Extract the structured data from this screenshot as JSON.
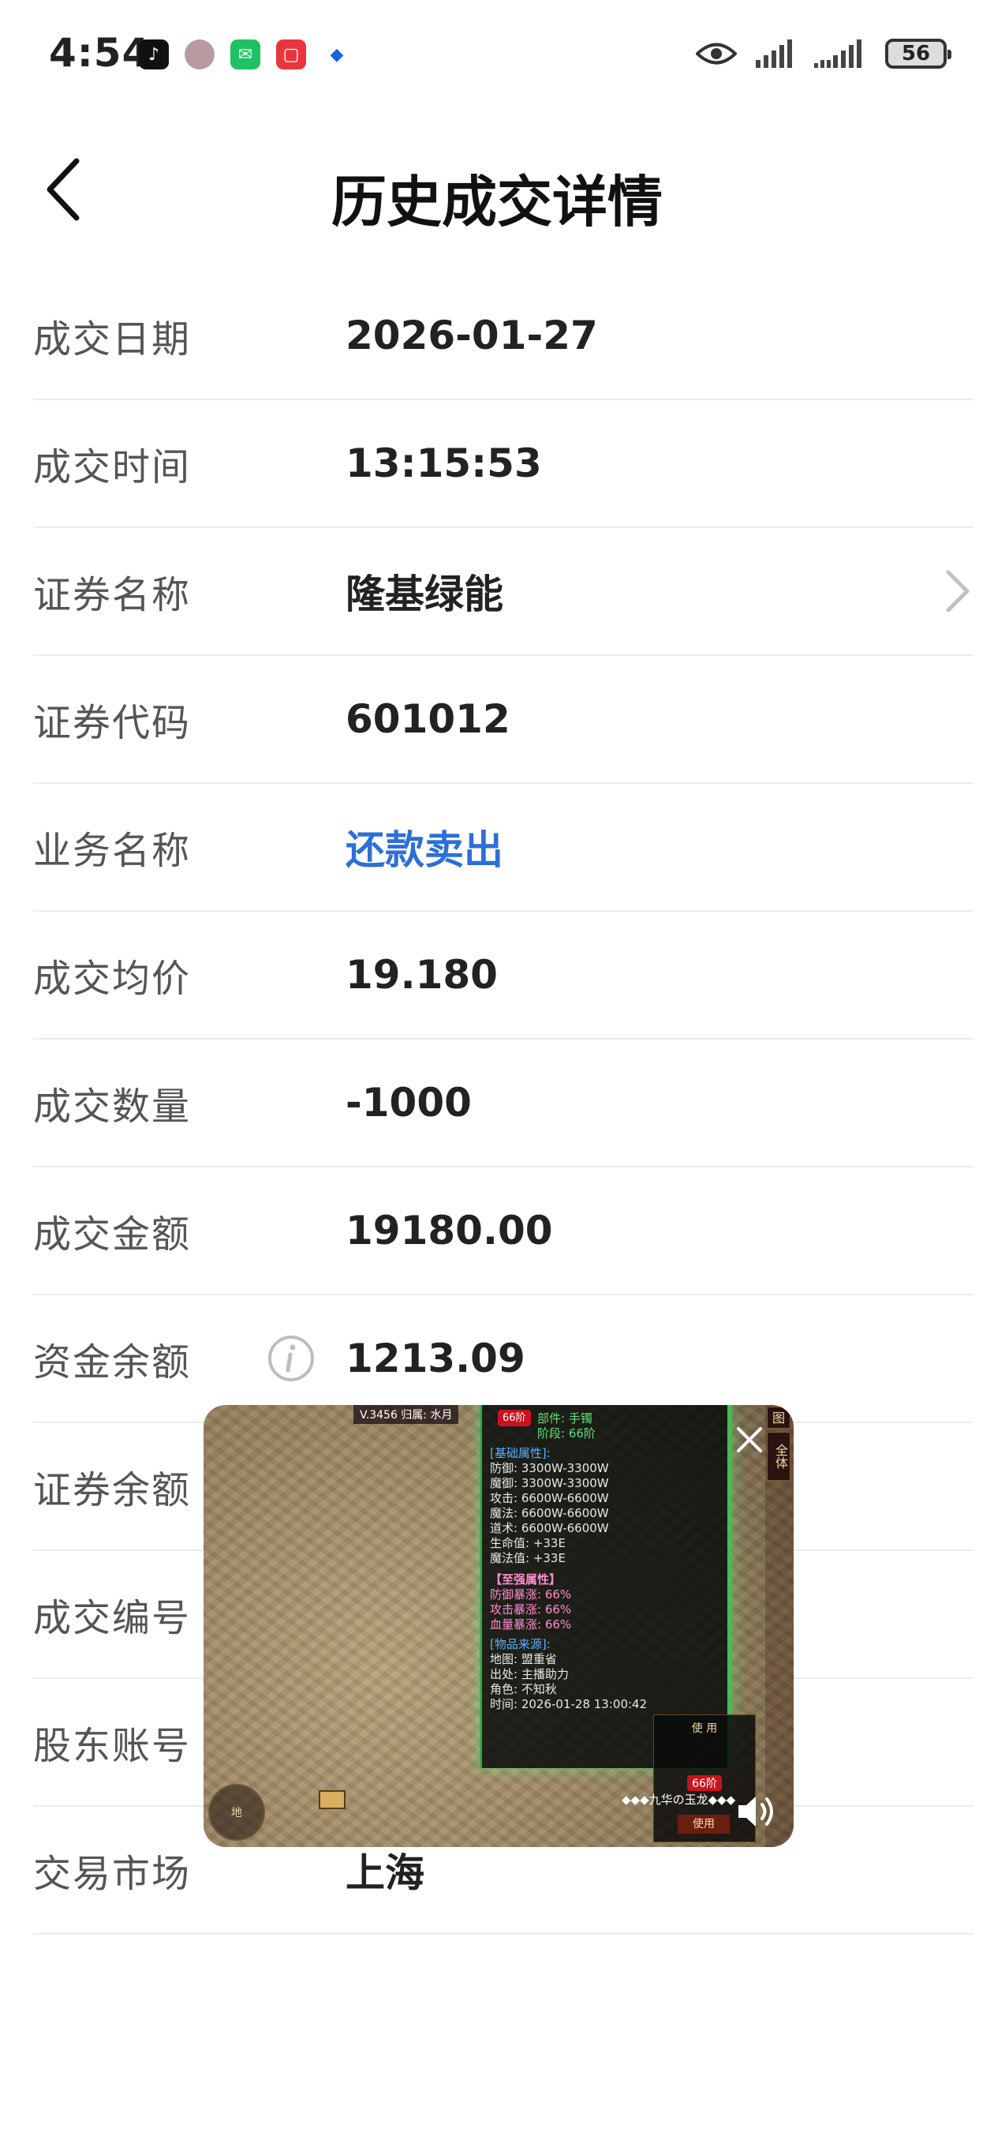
{
  "status_bar": {
    "time": "4:54",
    "battery": "56",
    "notifications": [
      "tiktok-icon",
      "avatar-icon",
      "wechat-icon",
      "red-app-icon",
      "blue-app-icon"
    ]
  },
  "header": {
    "title": "历史成交详情"
  },
  "rows": [
    {
      "label": "成交日期",
      "value": "2026-01-27"
    },
    {
      "label": "成交时间",
      "value": "13:15:53"
    },
    {
      "label": "证券名称",
      "value": "隆基绿能"
    },
    {
      "label": "证券代码",
      "value": "601012"
    },
    {
      "label": "业务名称",
      "value": "还款卖出"
    },
    {
      "label": "成交均价",
      "value": "19.180"
    },
    {
      "label": "成交数量",
      "value": "-1000"
    },
    {
      "label": "成交金额",
      "value": "19180.00"
    },
    {
      "label": "资金余额",
      "value": "1213.09"
    },
    {
      "label": "证券余额",
      "value": ""
    },
    {
      "label": "成交编号",
      "value": ""
    },
    {
      "label": "股东账号",
      "value": ""
    },
    {
      "label": "交易市场",
      "value": "上海"
    }
  ],
  "overlay": {
    "player_tag": "V.3456  归属: 水月",
    "part_line": "部件: 手镯",
    "stage_line": "阶段: 66阶",
    "badge": "66阶",
    "base_header": "[基础属性]:",
    "base_stats": [
      "防御: 3300W-3300W",
      "魔御: 3300W-3300W",
      "攻击: 6600W-6600W",
      "魔法: 6600W-6600W",
      "道术: 6600W-6600W",
      "生命值: +33E",
      "魔法值: +33E"
    ],
    "enhance_header": "【至强属性】",
    "enhance_stats": [
      "防御暴涨: 66%",
      "攻击暴涨: 66%",
      "血量暴涨: 66%"
    ],
    "source_header": "[物品来源]:",
    "source_stats": [
      "地图: 盟重省",
      "出处: 主播助力",
      "角色: 不知秋",
      "时间: 2026-01-28 13:00:42"
    ],
    "side_labels": [
      "图",
      "全体"
    ],
    "map_label": "地",
    "scroll_text": "◆◆◆九华の玉龙◆◆◆",
    "popup_title": "使 用",
    "popup_badge": "66阶",
    "popup_use": "使用"
  }
}
